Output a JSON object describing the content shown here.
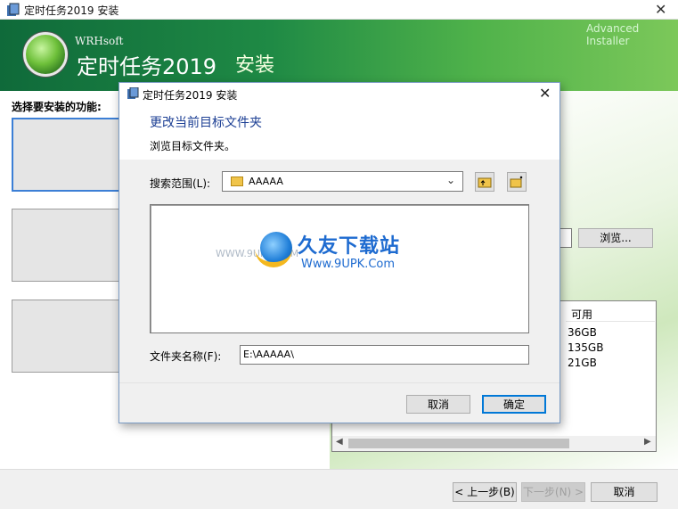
{
  "window": {
    "title": "定时任务2019 安装",
    "close_glyph": "✕"
  },
  "banner": {
    "company": "WRHsoft",
    "product": "定时任务2019",
    "word": "安装",
    "advanced": "Advanced Installer"
  },
  "features": {
    "label": "选择要安装的功能:"
  },
  "browse_label": "浏览...",
  "disk": {
    "header": "可用",
    "values": [
      "36GB",
      "135GB",
      "21GB"
    ]
  },
  "footer": {
    "back": "< 上一步(B)",
    "next": "下一步(N) >",
    "cancel": "取消"
  },
  "dialog": {
    "title": "定时任务2019 安装",
    "close_glyph": "✕",
    "heading": "更改当前目标文件夹",
    "subheading": "浏览目标文件夹。",
    "lookin_label": "搜索范围(L):",
    "lookin_value": "AAAAA",
    "folder_name_label": "文件夹名称(F):",
    "folder_name_value": "E:\\AAAAA\\",
    "cancel": "取消",
    "ok": "确定"
  },
  "watermark": {
    "cn": "久友下载站",
    "url": "Www.9UPK.Com",
    "faint": "WWW.9UPK.COM"
  },
  "colors": {
    "accent": "#0078d7",
    "heading": "#1c3f94",
    "banner_dark": "#0f6a3a",
    "banner_light": "#7cc85a"
  }
}
